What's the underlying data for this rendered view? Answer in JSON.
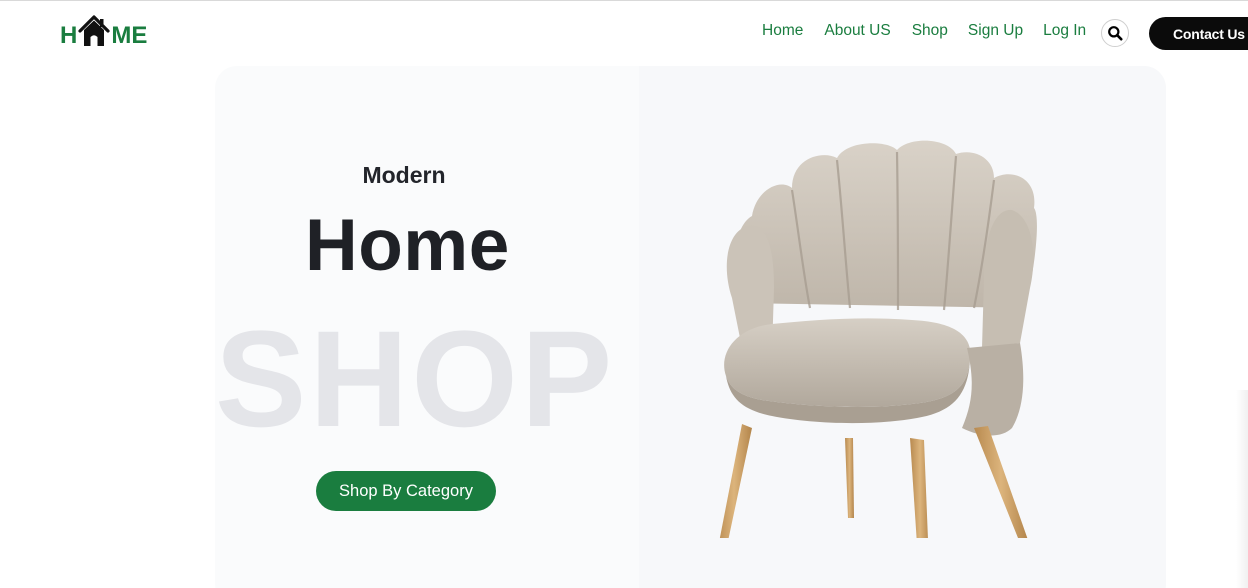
{
  "logo": {
    "left_text": "H",
    "right_text": "ME",
    "house_icon": "house-icon"
  },
  "nav": {
    "items": [
      {
        "label": "Home"
      },
      {
        "label": "About US"
      },
      {
        "label": "Shop"
      },
      {
        "label": "Sign Up"
      },
      {
        "label": "Log In"
      }
    ],
    "search_icon": "search-icon",
    "contact_label": "Contact Us"
  },
  "hero": {
    "eyebrow": "Modern",
    "title": "Home",
    "backdrop_word": "SHOP",
    "cta_label": "Shop By Category",
    "image": "armchair"
  },
  "colors": {
    "brand_green": "#1a7d3f",
    "dark": "#1f2126",
    "backdrop_text": "#e4e5e9",
    "contact_bg": "#0b0b0b"
  }
}
